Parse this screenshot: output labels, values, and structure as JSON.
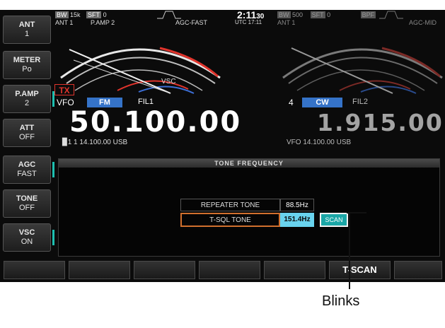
{
  "side_keys": [
    {
      "label": "ANT",
      "value": "1"
    },
    {
      "label": "METER",
      "value": "Po"
    },
    {
      "label": "P.AMP",
      "value": "2"
    },
    {
      "label": "ATT",
      "value": "OFF"
    },
    {
      "label": "AGC",
      "value": "FAST"
    },
    {
      "label": "TONE",
      "value": "OFF"
    },
    {
      "label": "VSC",
      "value": "ON"
    }
  ],
  "main": {
    "bw": "BW",
    "bw_val": "15k",
    "sft": "SFT",
    "sft_val": "0",
    "ant": "ANT 1",
    "pamp": "P.AMP 2",
    "agc": "AGC-FAST",
    "tx": "TX",
    "vsc": "VSC",
    "vfo": "VFO",
    "mode": "FM",
    "fil": "FIL1",
    "freq": "50.100.00",
    "sub_line": "▉1   1  14.100.00  USB"
  },
  "clock": {
    "time": "2:11",
    "sec": "30",
    "utc": "UTC 17:11"
  },
  "sub": {
    "bw": "BW",
    "bw_val": "500",
    "sft": "SFT",
    "sft_val": "0",
    "bpf": "BPF",
    "ant": "ANT 1",
    "agc": "AGC-MID",
    "num": "4",
    "mode": "CW",
    "fil": "FIL2",
    "freq": "1.915.00",
    "vfo_line": "VFO  14.100.00  USB"
  },
  "tone_panel": {
    "title": "TONE FREQUENCY",
    "repeater_label": "REPEATER TONE",
    "repeater_value": "88.5Hz",
    "tsql_label": "T-SQL TONE",
    "tsql_value": "151.4Hz",
    "scan": "SCAN"
  },
  "softkeys": [
    "",
    "",
    "",
    "",
    "",
    "T-SCAN",
    ""
  ],
  "callout": "Blinks",
  "colors": {
    "accent_blue": "#3573c8",
    "tone_cyan": "#69d3ee",
    "scan_teal": "#1aa6a6",
    "tsql_border": "#d1702e"
  }
}
